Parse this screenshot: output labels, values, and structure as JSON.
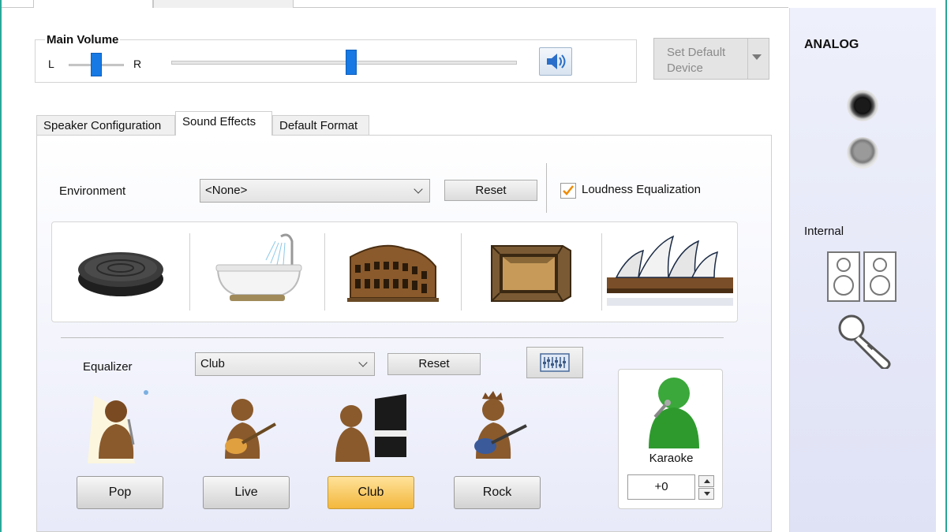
{
  "main_volume": {
    "title": "Main Volume",
    "balance_left": "L",
    "balance_right": "R",
    "volume_level": 0.52
  },
  "default_device": {
    "label": "Set Default Device"
  },
  "tabs": [
    {
      "label": "Speaker Configuration"
    },
    {
      "label": "Sound Effects",
      "selected": true
    },
    {
      "label": "Default Format"
    }
  ],
  "environment": {
    "label": "Environment",
    "value": "<None>",
    "reset_label": "Reset",
    "loudness_label": "Loudness Equalization",
    "loudness_checked": true,
    "presets": [
      "sewer-pipe",
      "bathroom",
      "colosseum",
      "stone-room",
      "concert-hall"
    ]
  },
  "equalizer": {
    "label": "Equalizer",
    "value": "Club",
    "reset_label": "Reset",
    "presets": [
      {
        "label": "Pop"
      },
      {
        "label": "Live"
      },
      {
        "label": "Club",
        "active": true
      },
      {
        "label": "Rock"
      }
    ]
  },
  "karaoke": {
    "label": "Karaoke",
    "value": "+0"
  },
  "right_panel": {
    "analog_label": "ANALOG",
    "internal_label": "Internal"
  },
  "colors": {
    "accent": "#1679e4",
    "active_preset": "#f3b73d",
    "check": "#f08a00"
  }
}
